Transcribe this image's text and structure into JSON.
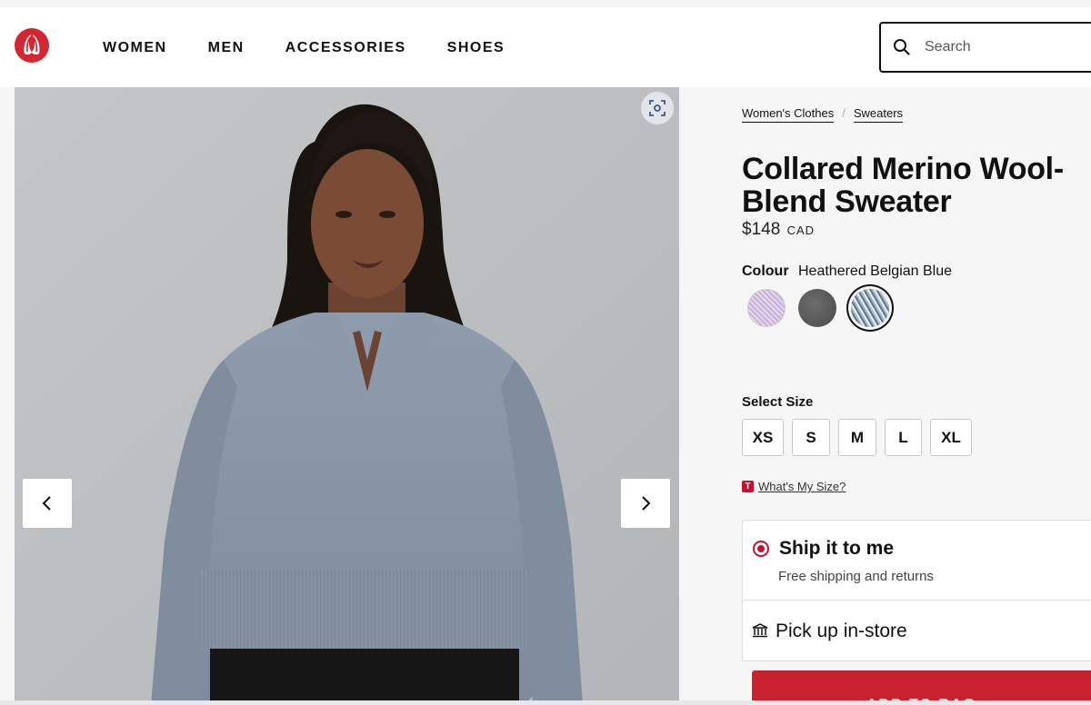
{
  "header": {
    "logo_name": "lululemon-logo-icon",
    "nav": [
      {
        "label": "WOMEN"
      },
      {
        "label": "MEN"
      },
      {
        "label": "ACCESSORIES"
      },
      {
        "label": "SHOES"
      }
    ],
    "search": {
      "placeholder": "Search",
      "icon": "search-icon"
    }
  },
  "gallery": {
    "zoom_icon": "scan-zoom-icon",
    "prev_icon": "chevron-left-icon",
    "next_icon": "chevron-right-icon"
  },
  "product": {
    "breadcrumb": [
      {
        "label": "Women's Clothes"
      },
      {
        "label": "Sweaters"
      }
    ],
    "breadcrumb_sep": "/",
    "title": "Collared Merino Wool-Blend Sweater",
    "price": "$148",
    "currency": "CAD",
    "colour_label": "Colour",
    "colour_value": "Heathered Belgian Blue",
    "swatches": [
      {
        "color": "#d9c6e3"
      },
      {
        "color": "#555555"
      },
      {
        "color": "#7f93ab",
        "selected": true
      }
    ],
    "size_label": "Select Size",
    "sizes": [
      "XS",
      "S",
      "M",
      "L",
      "XL"
    ],
    "fit_badge": "T",
    "fit_link": "What's My Size?"
  },
  "fulfillment": {
    "ship": {
      "title": "Ship it to me",
      "subtitle": "Free shipping and returns",
      "selected": true
    },
    "pickup": {
      "title": "Pick up in-store",
      "icon": "store-icon"
    },
    "add_to_bag": "ADD TO BAG"
  },
  "colors": {
    "brand_red": "#c8102e",
    "button_red": "#c8212f",
    "sweater": "#8392a3"
  }
}
